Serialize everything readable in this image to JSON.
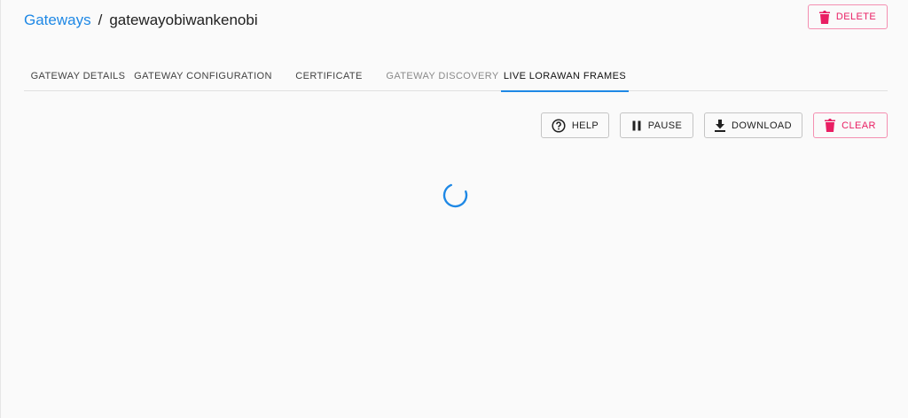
{
  "breadcrumb": {
    "parent": "Gateways",
    "separator": "/",
    "current": "gatewayobiwankenobi"
  },
  "header": {
    "delete_label": "DELETE"
  },
  "tabs": [
    {
      "label": "GATEWAY DETAILS",
      "state": "normal"
    },
    {
      "label": "GATEWAY CONFIGURATION",
      "state": "normal"
    },
    {
      "label": "CERTIFICATE",
      "state": "normal"
    },
    {
      "label": "GATEWAY DISCOVERY",
      "state": "disabled"
    },
    {
      "label": "LIVE LORAWAN FRAMES",
      "state": "active"
    }
  ],
  "toolbar": {
    "help_label": "HELP",
    "pause_label": "PAUSE",
    "download_label": "DOWNLOAD",
    "clear_label": "CLEAR"
  },
  "icons": {
    "delete": "trash-icon",
    "help": "help-circle-icon",
    "pause": "pause-icon",
    "download": "download-icon",
    "clear": "trash-icon",
    "loading": "loading-spinner"
  },
  "colors": {
    "accent": "#1e88e5",
    "danger": "#e91e63",
    "background": "#fafafa"
  }
}
